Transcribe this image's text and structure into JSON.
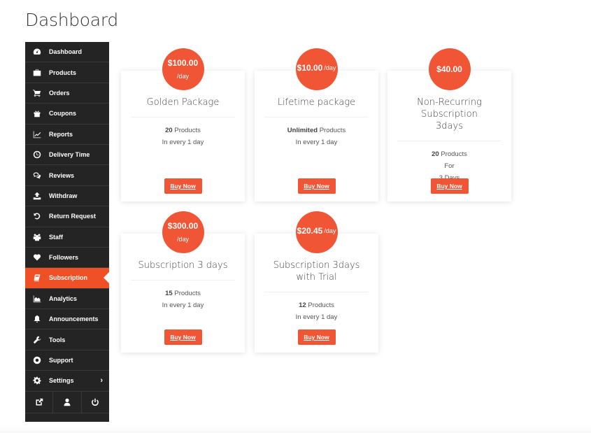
{
  "page": {
    "title": "Dashboard"
  },
  "colors": {
    "accent": "#f05536",
    "sidebar_bg": "#242424",
    "active_bg": "#f05025"
  },
  "sidebar": {
    "items": [
      {
        "label": "Dashboard",
        "icon": "dashboard-icon"
      },
      {
        "label": "Products",
        "icon": "briefcase-icon"
      },
      {
        "label": "Orders",
        "icon": "cart-icon"
      },
      {
        "label": "Coupons",
        "icon": "gift-icon"
      },
      {
        "label": "Reports",
        "icon": "line-chart-icon"
      },
      {
        "label": "Delivery Time",
        "icon": "clock-icon"
      },
      {
        "label": "Reviews",
        "icon": "comments-icon"
      },
      {
        "label": "Withdraw",
        "icon": "upload-icon"
      },
      {
        "label": "Return Request",
        "icon": "undo-icon"
      },
      {
        "label": "Staff",
        "icon": "users-icon"
      },
      {
        "label": "Followers",
        "icon": "heart-icon"
      },
      {
        "label": "Subscription",
        "icon": "book-icon",
        "active": true
      },
      {
        "label": "Analytics",
        "icon": "area-chart-icon"
      },
      {
        "label": "Announcements",
        "icon": "bell-icon"
      },
      {
        "label": "Tools",
        "icon": "wrench-icon"
      },
      {
        "label": "Support",
        "icon": "lifebuoy-icon"
      },
      {
        "label": "Settings",
        "icon": "gear-icon",
        "has_submenu": true
      }
    ],
    "bottom_icons": [
      "external-link-icon",
      "user-icon",
      "power-icon"
    ],
    "settings_chevron": "›"
  },
  "packages": [
    {
      "price": "$100.00",
      "period": "/day",
      "name": "Golden Package",
      "count": "20",
      "count_suffix": " Products",
      "line2": "In every 1 day",
      "button": "Buy Now"
    },
    {
      "price": "$10.00",
      "period": "/day",
      "name": "Lifetime package",
      "count": "Unlimited",
      "count_suffix": " Products",
      "line2": "In every 1 day",
      "button": "Buy Now"
    },
    {
      "price": "$40.00",
      "period": "",
      "name": "Non-Recurring Subscription 3days",
      "count": "20",
      "count_suffix": " Products",
      "line2": "For",
      "line3": "3 Days",
      "button": "Buy Now"
    },
    {
      "price": "$300.00",
      "period": "/day",
      "name": "Subscription 3 days",
      "count": "15",
      "count_suffix": " Products",
      "line2": "In every 1 day",
      "button": "Buy Now"
    },
    {
      "price": "$20.45",
      "period": "/day",
      "name": "Subscription 3days with Trial",
      "count": "12",
      "count_suffix": " Products",
      "line2": "In every 1 day",
      "button": "Buy Now"
    }
  ]
}
